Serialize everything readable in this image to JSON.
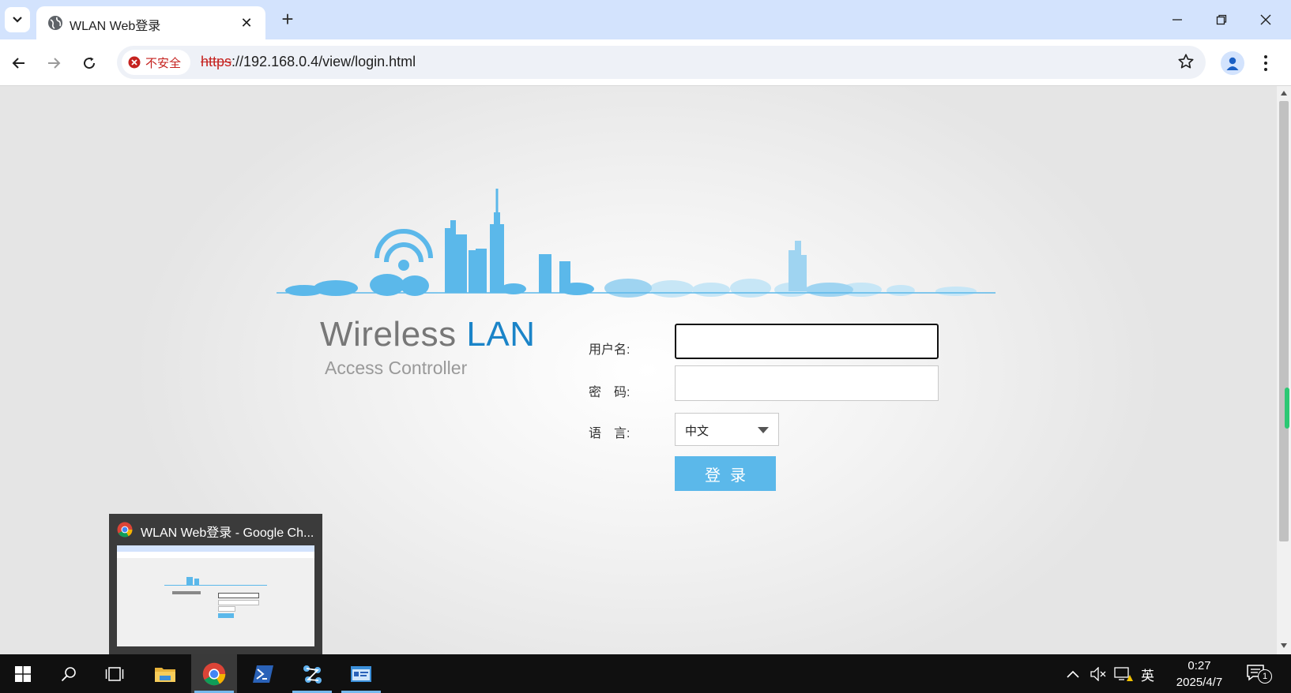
{
  "browser": {
    "tab_title": "WLAN Web登录",
    "security_label": "不安全",
    "url_scheme": "https",
    "url_rest": "://192.168.0.4/view/login.html"
  },
  "page": {
    "logo_wireless": "Wireless",
    "logo_lan": "LAN",
    "logo_subtitle": "Access Controller",
    "username_label": "用户名:",
    "password_label": "密　码:",
    "language_label": "语　言:",
    "language_value": "中文",
    "login_button": "登录"
  },
  "preview": {
    "title": "WLAN Web登录 - Google Ch..."
  },
  "taskbar": {
    "ime": "英",
    "time": "0:27",
    "date": "2025/4/7",
    "notification_count": "1"
  },
  "colors": {
    "accent": "#5bb8ea",
    "logo_blue": "#1b84c8",
    "insecure_red": "#c5221f"
  }
}
